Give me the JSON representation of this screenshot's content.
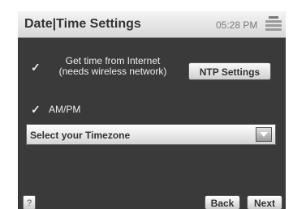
{
  "header": {
    "title": "Date|Time Settings",
    "time": "05:28 PM"
  },
  "settings": {
    "internet_time": {
      "checked": true,
      "label_line1": "Get time from Internet",
      "label_line2": "(needs wireless network)"
    },
    "ntp_button": "NTP Settings",
    "ampm": {
      "checked": true,
      "label": "AM/PM"
    },
    "timezone": {
      "selected": "Select your Timezone"
    }
  },
  "footer": {
    "help": "?",
    "back": "Back",
    "next": "Next"
  },
  "icons": {
    "check": "✓",
    "dropdown": "chevron-down-icon",
    "battery": "battery-icon"
  }
}
